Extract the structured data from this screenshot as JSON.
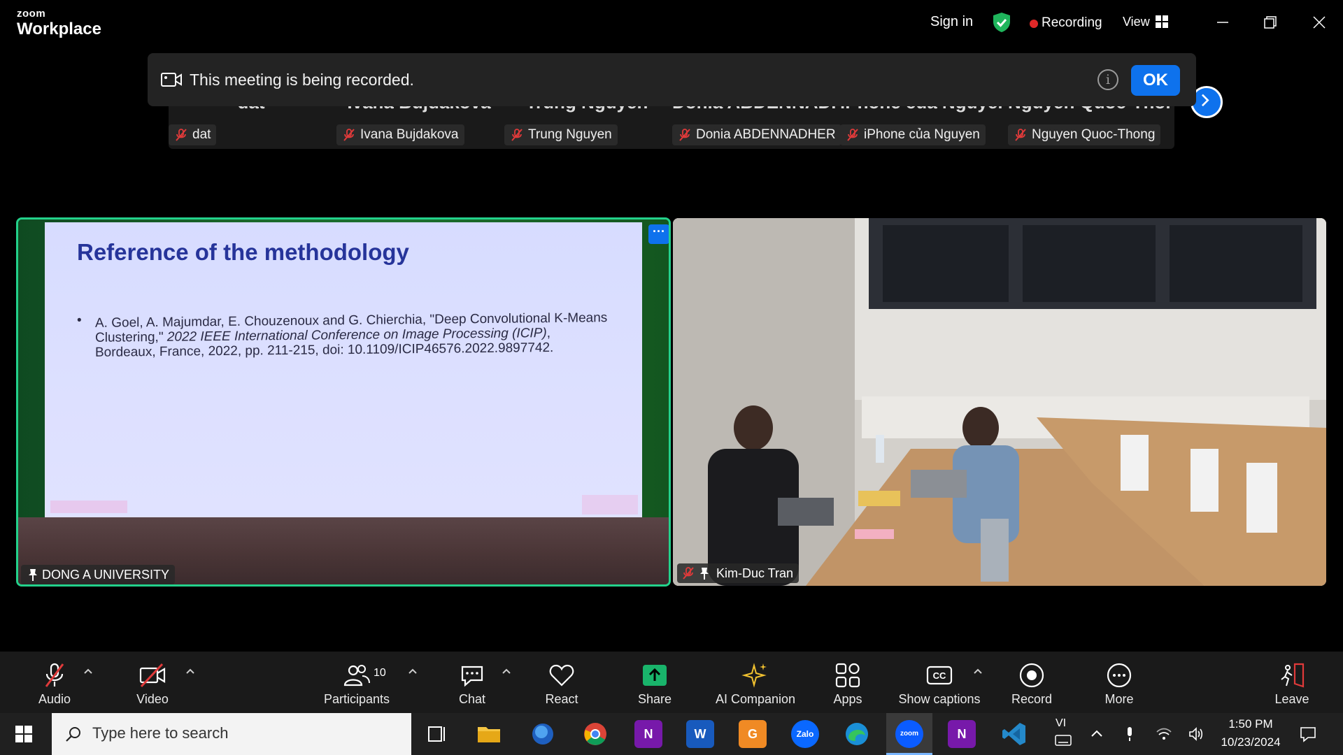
{
  "window": {
    "brand_small": "zoom",
    "brand_big": "Workplace",
    "sign_in": "Sign in",
    "recording_label": "Recording",
    "view_label": "View"
  },
  "banner": {
    "text": "This meeting is being recorded.",
    "info": "i",
    "ok_label": "OK"
  },
  "participants_strip": [
    {
      "big_name": "dat",
      "tag": "dat"
    },
    {
      "big_name": "Ivana Bujdakova",
      "tag": "Ivana Bujdakova"
    },
    {
      "big_name": "Trung Nguyen",
      "tag": "Trung Nguyen"
    },
    {
      "big_name": "Donia ABDENNADHER",
      "tag": "Donia ABDENNADHER"
    },
    {
      "big_name": "iPhone của Nguyen",
      "tag": "iPhone của Nguyen"
    },
    {
      "big_name": "Nguyen Quoc-Thong",
      "tag": "Nguyen Quoc-Thong"
    }
  ],
  "share_tile": {
    "more_label": "···",
    "name": "DONG A UNIVERSITY",
    "slide": {
      "title": "Reference of the methodology",
      "bullet": "•",
      "body_plain_1": "A. Goel, A. Majumdar, E. Chouzenoux and G. Chierchia, \"Deep Convolutional K-Means Clustering,\" ",
      "body_italic": "2022 IEEE International Conference on Image Processing (ICIP)",
      "body_plain_2": ", Bordeaux, France, 2022, pp. 211-215, doi: 10.1109/ICIP46576.2022.9897742."
    }
  },
  "cam_tile": {
    "name": "Kim-Duc Tran"
  },
  "toolbar": {
    "audio": "Audio",
    "video": "Video",
    "participants": "Participants",
    "participants_count": "10",
    "chat": "Chat",
    "react": "React",
    "share": "Share",
    "ai_companion": "AI Companion",
    "apps": "Apps",
    "show_captions": "Show captions",
    "record": "Record",
    "more": "More",
    "leave": "Leave"
  },
  "taskbar": {
    "search_placeholder": "Type here to search",
    "language": "VI",
    "time": "1:50 PM",
    "date": "10/23/2024",
    "apps": [
      "task-view",
      "file-explorer",
      "app-blue-sphere",
      "chrome",
      "onenote-x",
      "word",
      "pdf-app",
      "zalo",
      "edge",
      "zoom",
      "onenote",
      "vscode"
    ]
  },
  "colors": {
    "accent": "#0e72ed",
    "active_speaker": "#23d18b",
    "recording": "#e02828",
    "share_green": "#19b46b",
    "muted_red": "#e03a3a"
  }
}
